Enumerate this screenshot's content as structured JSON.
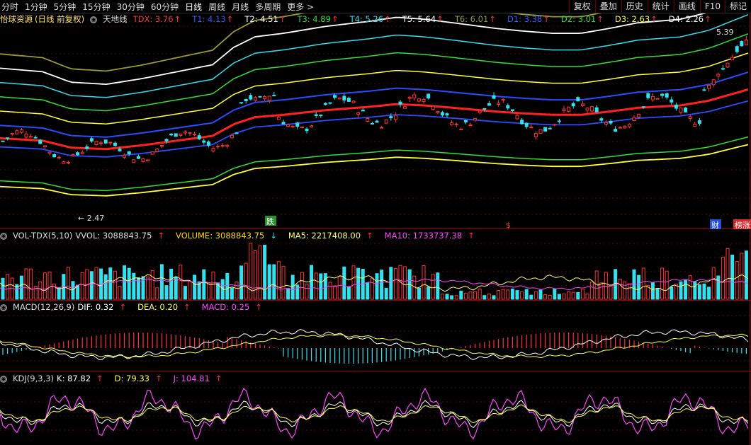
{
  "toolbar": {
    "periods": [
      "分时",
      "1分钟",
      "5分钟",
      "15分钟",
      "30分钟",
      "60分钟",
      "日线",
      "周线",
      "月线",
      "多周期",
      "更多 >"
    ],
    "active_period": "日线",
    "right_buttons": [
      "复权",
      "叠加",
      "历史",
      "统计",
      "画线",
      "F10",
      "标记"
    ]
  },
  "main": {
    "stock_name": "怡球资源",
    "mode": "(日线 前复权)",
    "indicator": "天地线",
    "lines": [
      {
        "name": "TDX",
        "value": "3.76",
        "color": "#ff3333"
      },
      {
        "name": "T1",
        "value": "4.13",
        "color": "#2a5cff"
      },
      {
        "name": "T2",
        "value": "4.51",
        "color": "#ffffff"
      },
      {
        "name": "T3",
        "value": "4.89",
        "color": "#33dd33"
      },
      {
        "name": "T4",
        "value": "5.26",
        "color": "#33ddee"
      },
      {
        "name": "T5",
        "value": "5.64",
        "color": "#ffffff"
      },
      {
        "name": "T6",
        "value": "6.01",
        "color": "#999933"
      },
      {
        "name": "D1",
        "value": "3.38",
        "color": "#2a5cff"
      },
      {
        "name": "D2",
        "value": "3.01",
        "color": "#33dd33"
      },
      {
        "name": "D3",
        "value": "2.63",
        "color": "#ffff33"
      },
      {
        "name": "D4",
        "value": "2.26",
        "color": "#ffffff"
      }
    ],
    "high_label": "5.39",
    "low_label": "2.47",
    "markers": [
      "跌",
      "$",
      "财",
      "榜涨"
    ]
  },
  "vol": {
    "name": "VOL-TDX(5,10)",
    "vvol_label": "VVOL: 3088843.75",
    "volume_label": "VOLUME: 3088843.75",
    "ma5_label": "MA5: 2217408.00",
    "ma10_label": "MA10: 1733737.38"
  },
  "macd": {
    "name": "MACD(12,26,9)",
    "dif_label": "DIF: 0.32",
    "dea_label": "DEA: 0.20",
    "macd_label": "MACD: 0.25"
  },
  "kdj": {
    "name": "KDJ(9,3,3)",
    "k_label": "K: 87.82",
    "d_label": "D: 79.33",
    "j_label": "J: 104.81"
  },
  "colors": {
    "up": "#ff3333",
    "down": "#33e0ee",
    "frame": "#a00000"
  }
}
